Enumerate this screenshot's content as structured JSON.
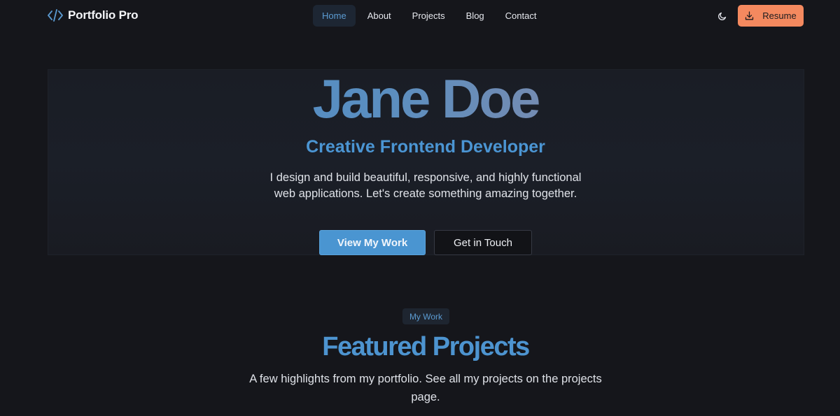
{
  "nav": {
    "brand": "Portfolio Pro",
    "brand_icon": "code-brackets-icon",
    "items": [
      {
        "label": "Home",
        "active": true
      },
      {
        "label": "About",
        "active": false
      },
      {
        "label": "Projects",
        "active": false
      },
      {
        "label": "Blog",
        "active": false
      },
      {
        "label": "Contact",
        "active": false
      }
    ],
    "theme_icon": "moon-icon",
    "resume_label": "Resume",
    "resume_icon": "download-icon"
  },
  "hero": {
    "name": "Jane Doe",
    "role": "Creative Frontend Developer",
    "description": "I design and build beautiful, responsive, and highly functional web applications. Let's create something amazing together.",
    "primary_cta": "View My Work",
    "secondary_cta": "Get in Touch"
  },
  "projects": {
    "badge": "My Work",
    "title": "Featured Projects",
    "description": "A few highlights from my portfolio. See all my projects on the projects page."
  },
  "colors": {
    "background": "#15161b",
    "accent_blue": "#4a95d1",
    "accent_orange": "#f4895f",
    "name_gradient_end": "#c38a8a"
  }
}
